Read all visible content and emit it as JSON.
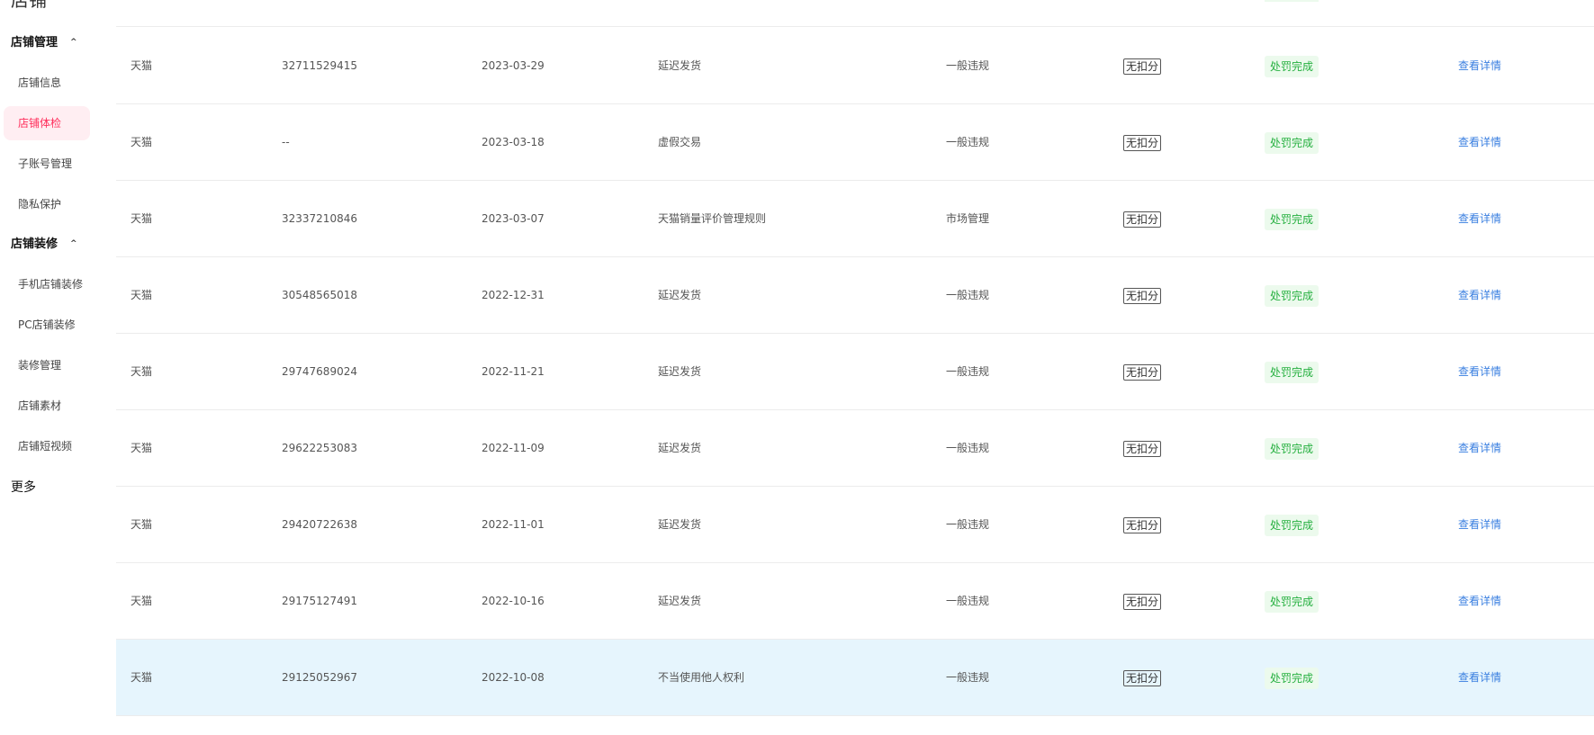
{
  "sidebar": {
    "title": "店铺",
    "groups": [
      {
        "label": "店铺管理",
        "chevron": "chevron-up-icon"
      },
      {
        "label": "店铺装修",
        "chevron": "chevron-up-icon"
      }
    ],
    "items": [
      {
        "label": "店铺信息",
        "active": false
      },
      {
        "label": "店铺体检",
        "active": true
      },
      {
        "label": "子账号管理",
        "active": false
      },
      {
        "label": "隐私保护",
        "active": false
      },
      {
        "label": "手机店铺装修",
        "active": false
      },
      {
        "label": "PC店铺装修",
        "active": false
      },
      {
        "label": "装修管理",
        "active": false
      },
      {
        "label": "店铺素材",
        "active": false
      },
      {
        "label": "店铺短视频",
        "active": false
      }
    ],
    "more": "更多"
  },
  "colors": {
    "accent": "#ff2e5b",
    "active_bg": "#ffeef2",
    "status_green": "#26b040",
    "status_green_bg": "#ecfaed",
    "link_blue": "#3a7fe0",
    "row_highlight": "#e6f5fd"
  },
  "table": {
    "rows": [
      {
        "platform": "天猫",
        "id": "32711529415",
        "date": "2023-03-29",
        "reason": "延迟发货",
        "type": "一般违规",
        "score": "无扣分",
        "status": "处罚完成",
        "action": "查看详情"
      },
      {
        "platform": "天猫",
        "id": "--",
        "date": "2023-03-18",
        "reason": "虚假交易",
        "type": "一般违规",
        "score": "无扣分",
        "status": "处罚完成",
        "action": "查看详情"
      },
      {
        "platform": "天猫",
        "id": "32337210846",
        "date": "2023-03-07",
        "reason": "天猫销量评价管理规则",
        "type": "市场管理",
        "score": "无扣分",
        "status": "处罚完成",
        "action": "查看详情"
      },
      {
        "platform": "天猫",
        "id": "30548565018",
        "date": "2022-12-31",
        "reason": "延迟发货",
        "type": "一般违规",
        "score": "无扣分",
        "status": "处罚完成",
        "action": "查看详情"
      },
      {
        "platform": "天猫",
        "id": "29747689024",
        "date": "2022-11-21",
        "reason": "延迟发货",
        "type": "一般违规",
        "score": "无扣分",
        "status": "处罚完成",
        "action": "查看详情"
      },
      {
        "platform": "天猫",
        "id": "29622253083",
        "date": "2022-11-09",
        "reason": "延迟发货",
        "type": "一般违规",
        "score": "无扣分",
        "status": "处罚完成",
        "action": "查看详情"
      },
      {
        "platform": "天猫",
        "id": "29420722638",
        "date": "2022-11-01",
        "reason": "延迟发货",
        "type": "一般违规",
        "score": "无扣分",
        "status": "处罚完成",
        "action": "查看详情"
      },
      {
        "platform": "天猫",
        "id": "29175127491",
        "date": "2022-10-16",
        "reason": "延迟发货",
        "type": "一般违规",
        "score": "无扣分",
        "status": "处罚完成",
        "action": "查看详情"
      },
      {
        "platform": "天猫",
        "id": "29125052967",
        "date": "2022-10-08",
        "reason": "不当使用他人权利",
        "type": "一般违规",
        "score": "无扣分",
        "status": "处罚完成",
        "action": "查看详情",
        "highlighted": true
      }
    ]
  }
}
